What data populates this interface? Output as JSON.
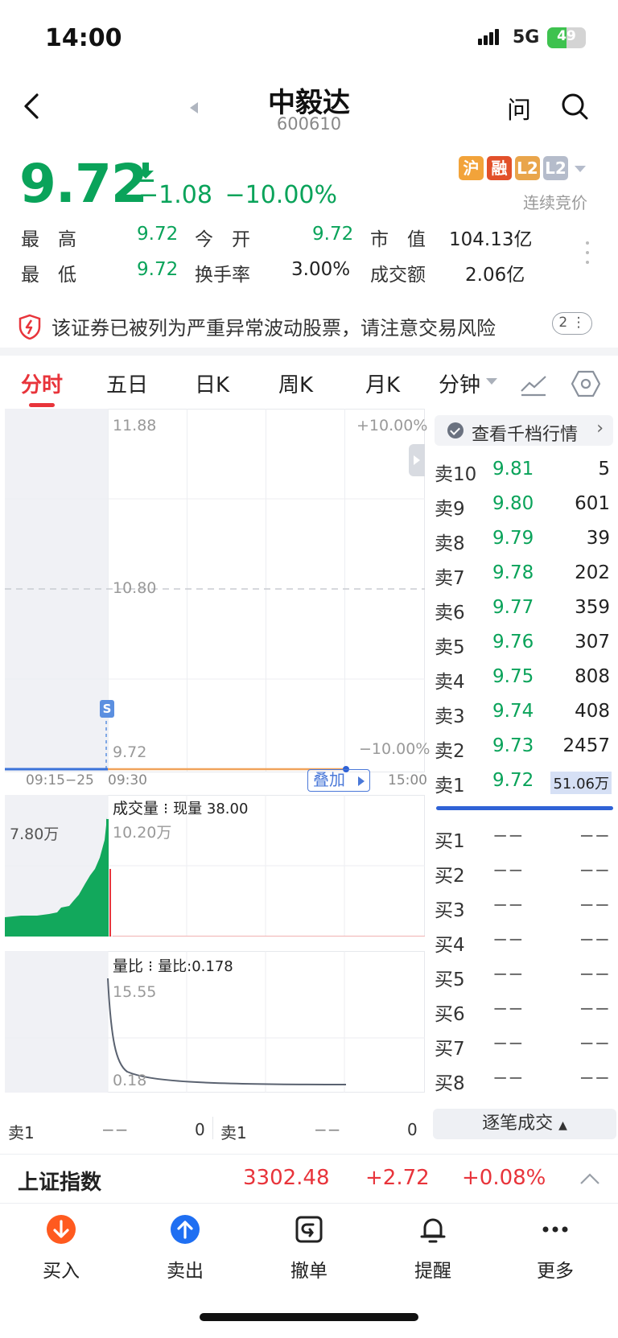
{
  "status_bar": {
    "time": "14:00",
    "network": "5G",
    "battery": "49"
  },
  "header": {
    "title": "中毅达",
    "code": "600610",
    "ask_label": "问"
  },
  "quote": {
    "price": "9.72",
    "change": "−1.08",
    "change_pct": "−10.00%",
    "badges": [
      "沪",
      "融",
      "L2",
      "L2"
    ],
    "auction_status": "连续竞价",
    "stats": [
      {
        "label": "最　高",
        "value": "9.72"
      },
      {
        "label": "今　开",
        "value": "9.72"
      },
      {
        "label": "市　值",
        "value": "104.13亿"
      },
      {
        "label": "最　低",
        "value": "9.72"
      },
      {
        "label": "换手率",
        "value": "3.00%"
      },
      {
        "label": "成交额",
        "value": "2.06亿"
      }
    ]
  },
  "warning": {
    "text": "该证券已被列为严重异常波动股票，请注意交易风险",
    "count": "2"
  },
  "tabs": [
    "分时",
    "五日",
    "日K",
    "周K",
    "月K",
    "分钟"
  ],
  "intraday_chart": {
    "y_top": "11.88",
    "y_mid": "10.80",
    "y_bottom": "9.72",
    "pct_top": "+10.00%",
    "pct_bottom": "−10.00%",
    "time_start": "09:15−25",
    "time_open": "09:30",
    "time_close": "15:00",
    "overlay_label": "叠加",
    "s_marker": "S"
  },
  "volume_chart": {
    "title": "成交量",
    "current": "现量 38.00",
    "pre_max": "7.80万",
    "max": "10.20万"
  },
  "ratio_chart": {
    "title": "量比",
    "current": "量比:0.178",
    "max": "15.55",
    "min": "0.18"
  },
  "mini_rows": [
    {
      "label": "卖1",
      "price": "−−",
      "qty": "0"
    },
    {
      "label": "卖1",
      "price": "−−",
      "qty": "0"
    }
  ],
  "order_book": {
    "button_label": "查看千档行情",
    "asks": [
      {
        "label": "卖10",
        "price": "9.81",
        "qty": "5"
      },
      {
        "label": "卖9",
        "price": "9.80",
        "qty": "601"
      },
      {
        "label": "卖8",
        "price": "9.79",
        "qty": "39"
      },
      {
        "label": "卖7",
        "price": "9.78",
        "qty": "202"
      },
      {
        "label": "卖6",
        "price": "9.77",
        "qty": "359"
      },
      {
        "label": "卖5",
        "price": "9.76",
        "qty": "307"
      },
      {
        "label": "卖4",
        "price": "9.75",
        "qty": "808"
      },
      {
        "label": "卖3",
        "price": "9.74",
        "qty": "408"
      },
      {
        "label": "卖2",
        "price": "9.73",
        "qty": "2457"
      },
      {
        "label": "卖1",
        "price": "9.72",
        "qty": "51.06万"
      }
    ],
    "bids": [
      {
        "label": "买1",
        "price": "−−",
        "qty": "−−"
      },
      {
        "label": "买2",
        "price": "−−",
        "qty": "−−"
      },
      {
        "label": "买3",
        "price": "−−",
        "qty": "−−"
      },
      {
        "label": "买4",
        "price": "−−",
        "qty": "−−"
      },
      {
        "label": "买5",
        "price": "−−",
        "qty": "−−"
      },
      {
        "label": "买6",
        "price": "−−",
        "qty": "−−"
      },
      {
        "label": "买7",
        "price": "−−",
        "qty": "−−"
      },
      {
        "label": "买8",
        "price": "−−",
        "qty": "−−"
      }
    ],
    "trades_label": "逐笔成交"
  },
  "index_bar": {
    "name": "上证指数",
    "value": "3302.48",
    "change": "+2.72",
    "pct": "+0.08%"
  },
  "bottom_nav": [
    {
      "label": "买入",
      "icon": "buy-arrow-icon"
    },
    {
      "label": "卖出",
      "icon": "sell-arrow-icon"
    },
    {
      "label": "撤单",
      "icon": "cancel-order-icon"
    },
    {
      "label": "提醒",
      "icon": "bell-icon"
    },
    {
      "label": "更多",
      "icon": "more-dots-icon"
    }
  ],
  "colors": {
    "down": "#0aa35a",
    "up": "#e8343b",
    "accent": "#2f62d6"
  }
}
